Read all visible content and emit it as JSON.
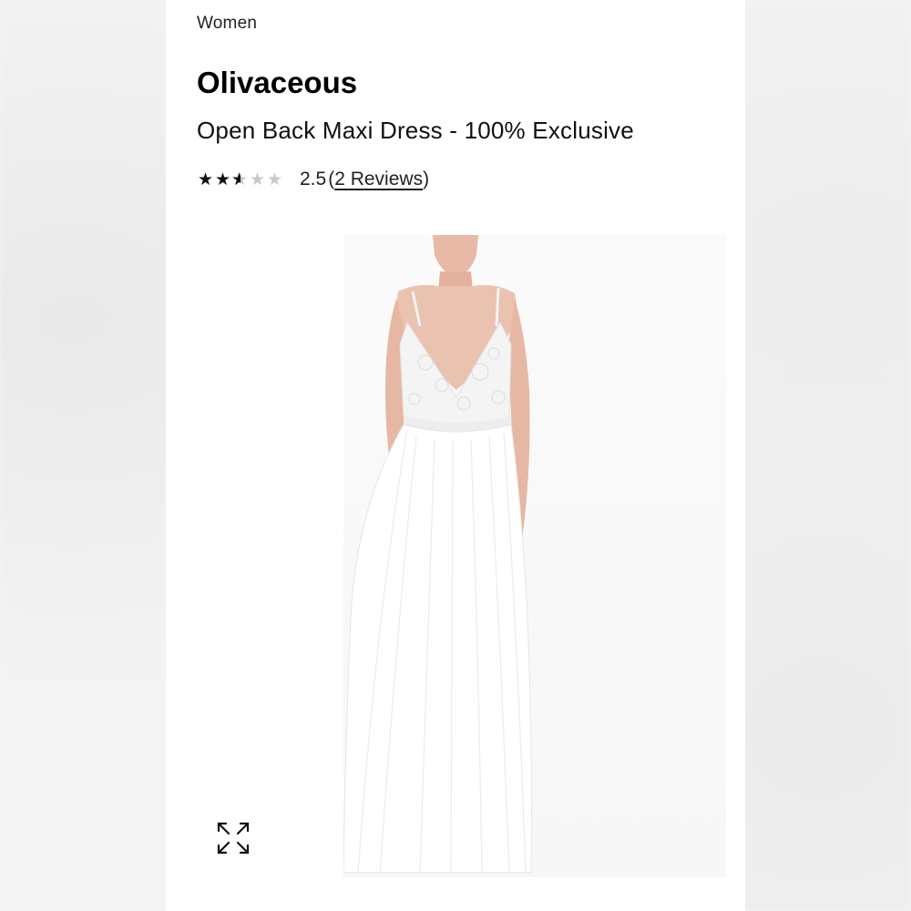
{
  "breadcrumb": "Women",
  "brand": "Olivaceous",
  "product_name": "Open Back Maxi Dress - 100% Exclusive",
  "rating": {
    "value": 2.5,
    "max": 5,
    "value_text": "2.5",
    "open_paren": "(",
    "reviews_label": "2 Reviews",
    "close_paren": ")"
  },
  "icons": {
    "expand": "expand-icon",
    "star": "star-icon"
  },
  "colors": {
    "star_filled": "#111111",
    "star_empty": "#c8c8c8",
    "dress": "#ffffff",
    "skin": "#e8b9a6"
  }
}
